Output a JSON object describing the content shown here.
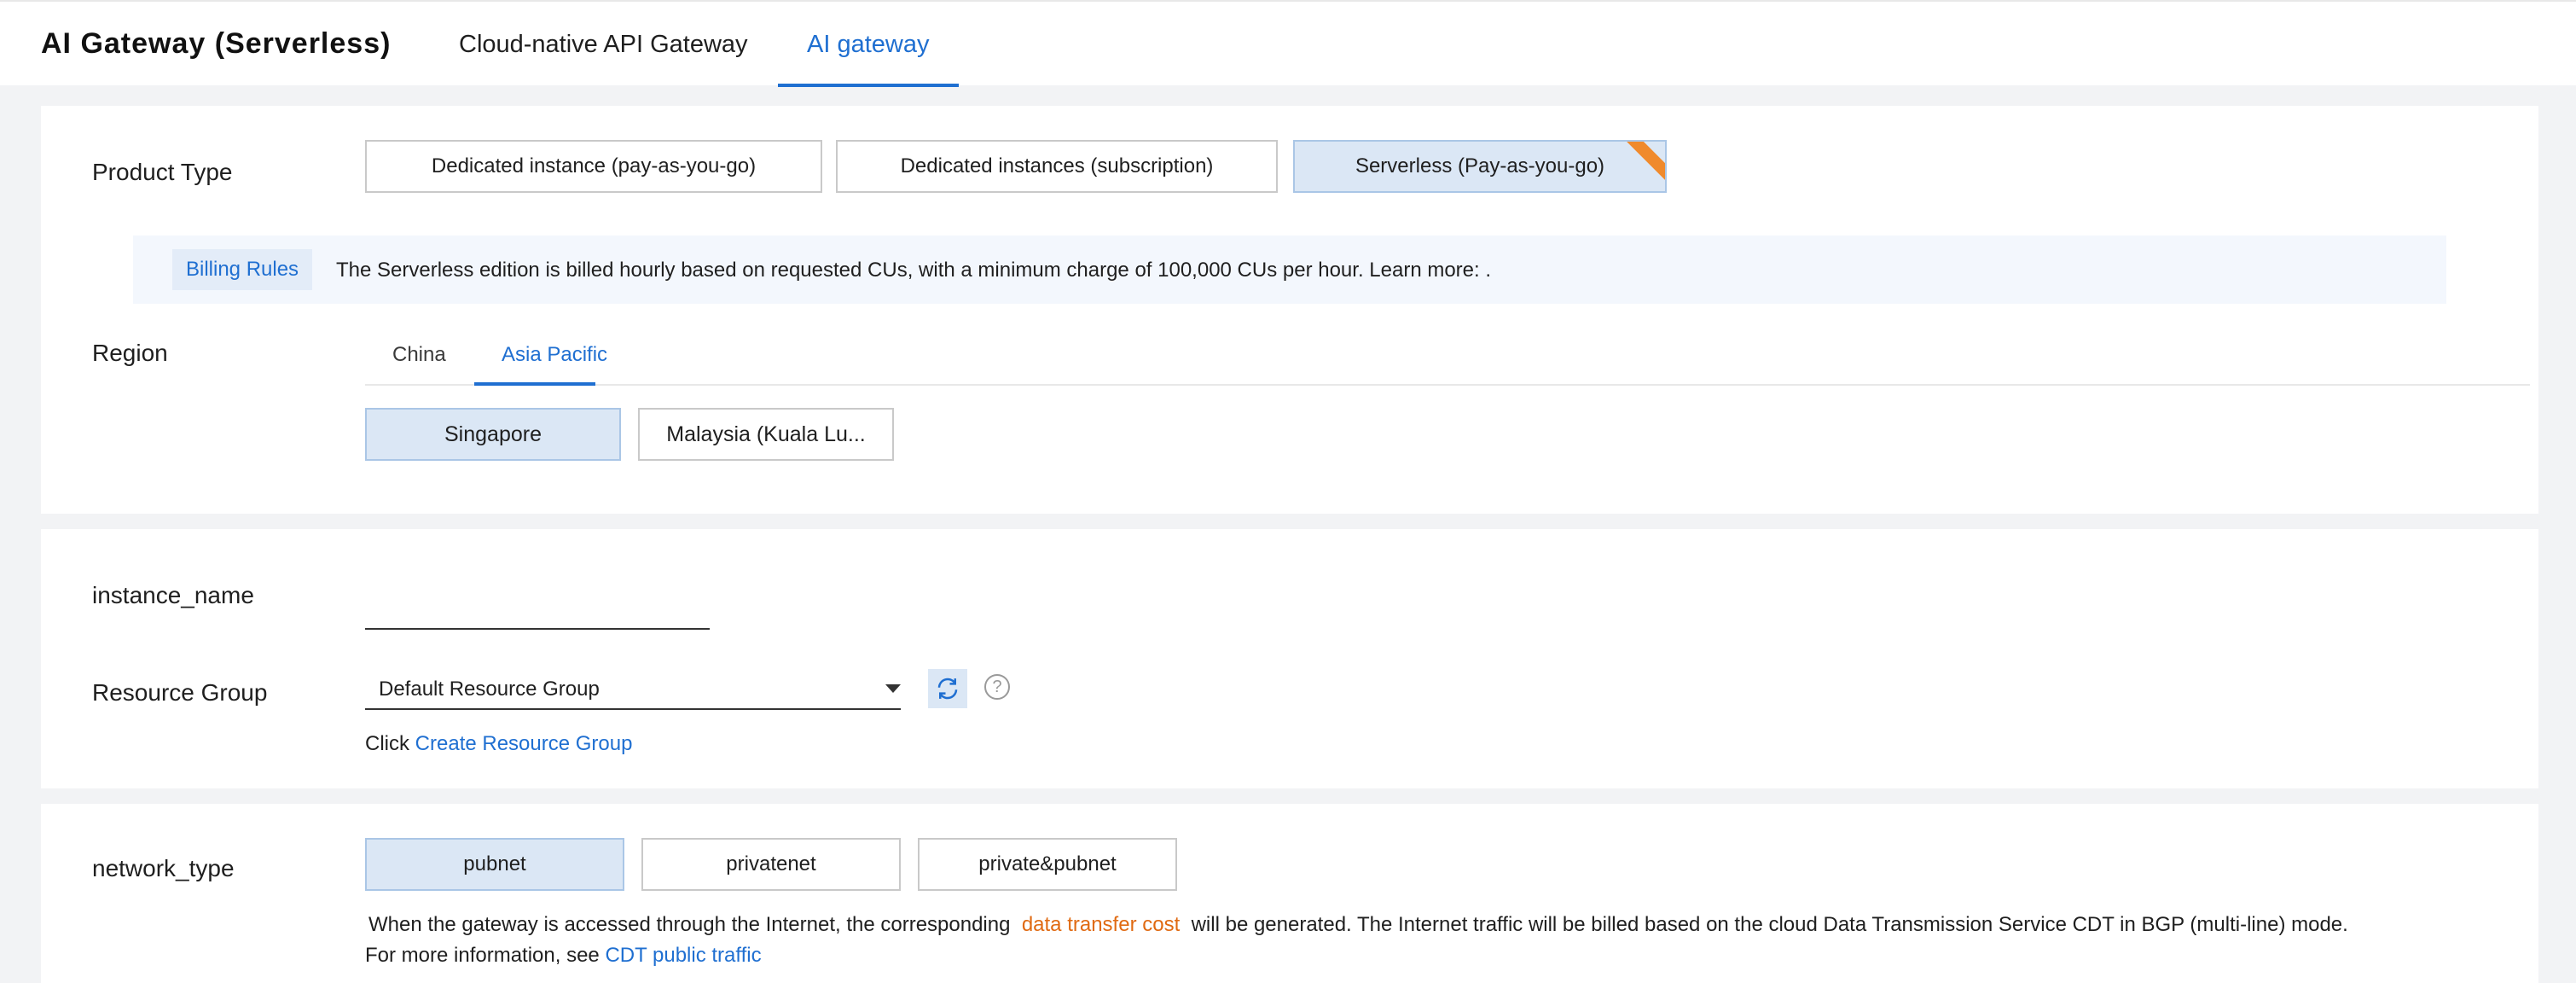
{
  "header": {
    "app_title": "AI Gateway (Serverless)",
    "tabs": [
      {
        "label": "Cloud-native API Gateway",
        "active": false
      },
      {
        "label": "AI gateway",
        "active": true
      }
    ]
  },
  "product_type": {
    "label": "Product Type",
    "options": [
      {
        "label": "Dedicated instance (pay-as-you-go)",
        "selected": false
      },
      {
        "label": "Dedicated instances (subscription)",
        "selected": false
      },
      {
        "label": "Serverless (Pay-as-you-go)",
        "selected": true
      }
    ],
    "billing": {
      "tag": "Billing Rules",
      "text": "The Serverless edition is billed hourly based on requested CUs, with a minimum charge of 100,000 CUs per hour. Learn more: ."
    }
  },
  "region": {
    "label": "Region",
    "tabs": [
      {
        "label": "China",
        "active": false
      },
      {
        "label": "Asia Pacific",
        "active": true
      }
    ],
    "options": [
      {
        "label": "Singapore",
        "selected": true
      },
      {
        "label": "Malaysia (Kuala Lu...",
        "selected": false
      }
    ]
  },
  "instance": {
    "name_label": "instance_name",
    "name_value": "",
    "resource_group_label": "Resource Group",
    "resource_group_value": "Default Resource Group",
    "hint_prefix": "Click",
    "create_link": "Create Resource Group"
  },
  "network": {
    "label": "network_type",
    "options": [
      {
        "label": "pubnet",
        "selected": true
      },
      {
        "label": "privatenet",
        "selected": false
      },
      {
        "label": "private&pubnet",
        "selected": false
      }
    ],
    "desc_before": "When the gateway is accessed through the Internet, the corresponding",
    "desc_link": "data transfer cost",
    "desc_after": "will be generated. The Internet traffic will be billed based on the cloud Data Transmission Service CDT in BGP (multi-line) mode.",
    "more_prefix": "For more information, see",
    "more_link": "CDT public traffic"
  },
  "colors": {
    "accent": "#1f6fd1",
    "selected_bg": "#dbe7f5",
    "ribbon": "#f08a2c",
    "warning_link": "#e06a12"
  }
}
